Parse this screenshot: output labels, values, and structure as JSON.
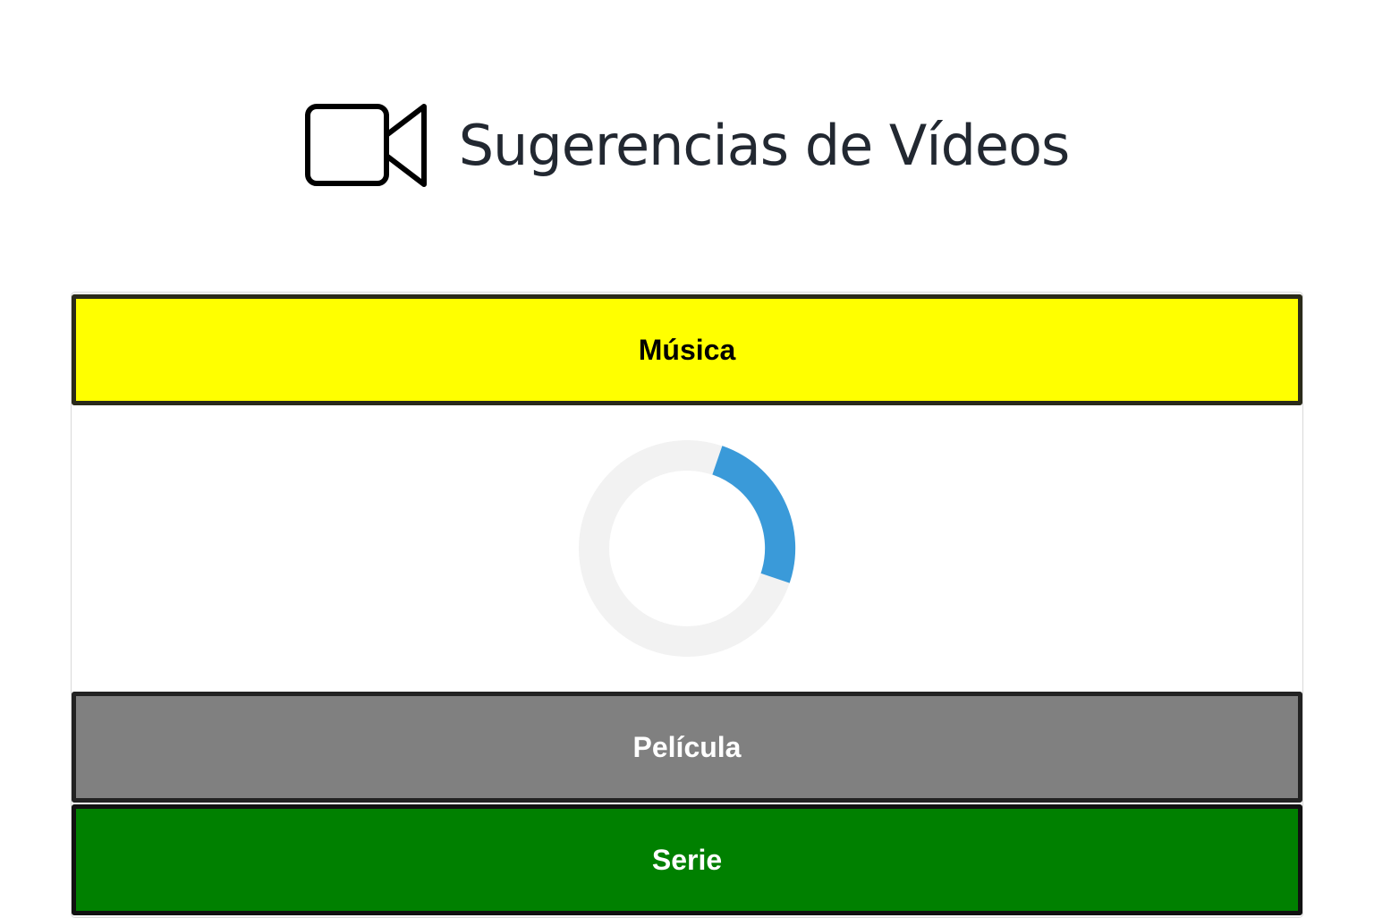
{
  "header": {
    "title": "Sugerencias de Vídeos",
    "icon": "video-camera-icon"
  },
  "categories": [
    {
      "label": "Música",
      "color": "#ffff00",
      "text_color": "#000000"
    },
    {
      "label": "Película",
      "color": "#808080",
      "text_color": "#ffffff"
    },
    {
      "label": "Serie",
      "color": "#008000",
      "text_color": "#ffffff"
    }
  ],
  "loading": {
    "icon": "loading-spinner-icon",
    "track_color": "#f2f2f2",
    "arc_color": "#3a9ad9"
  }
}
